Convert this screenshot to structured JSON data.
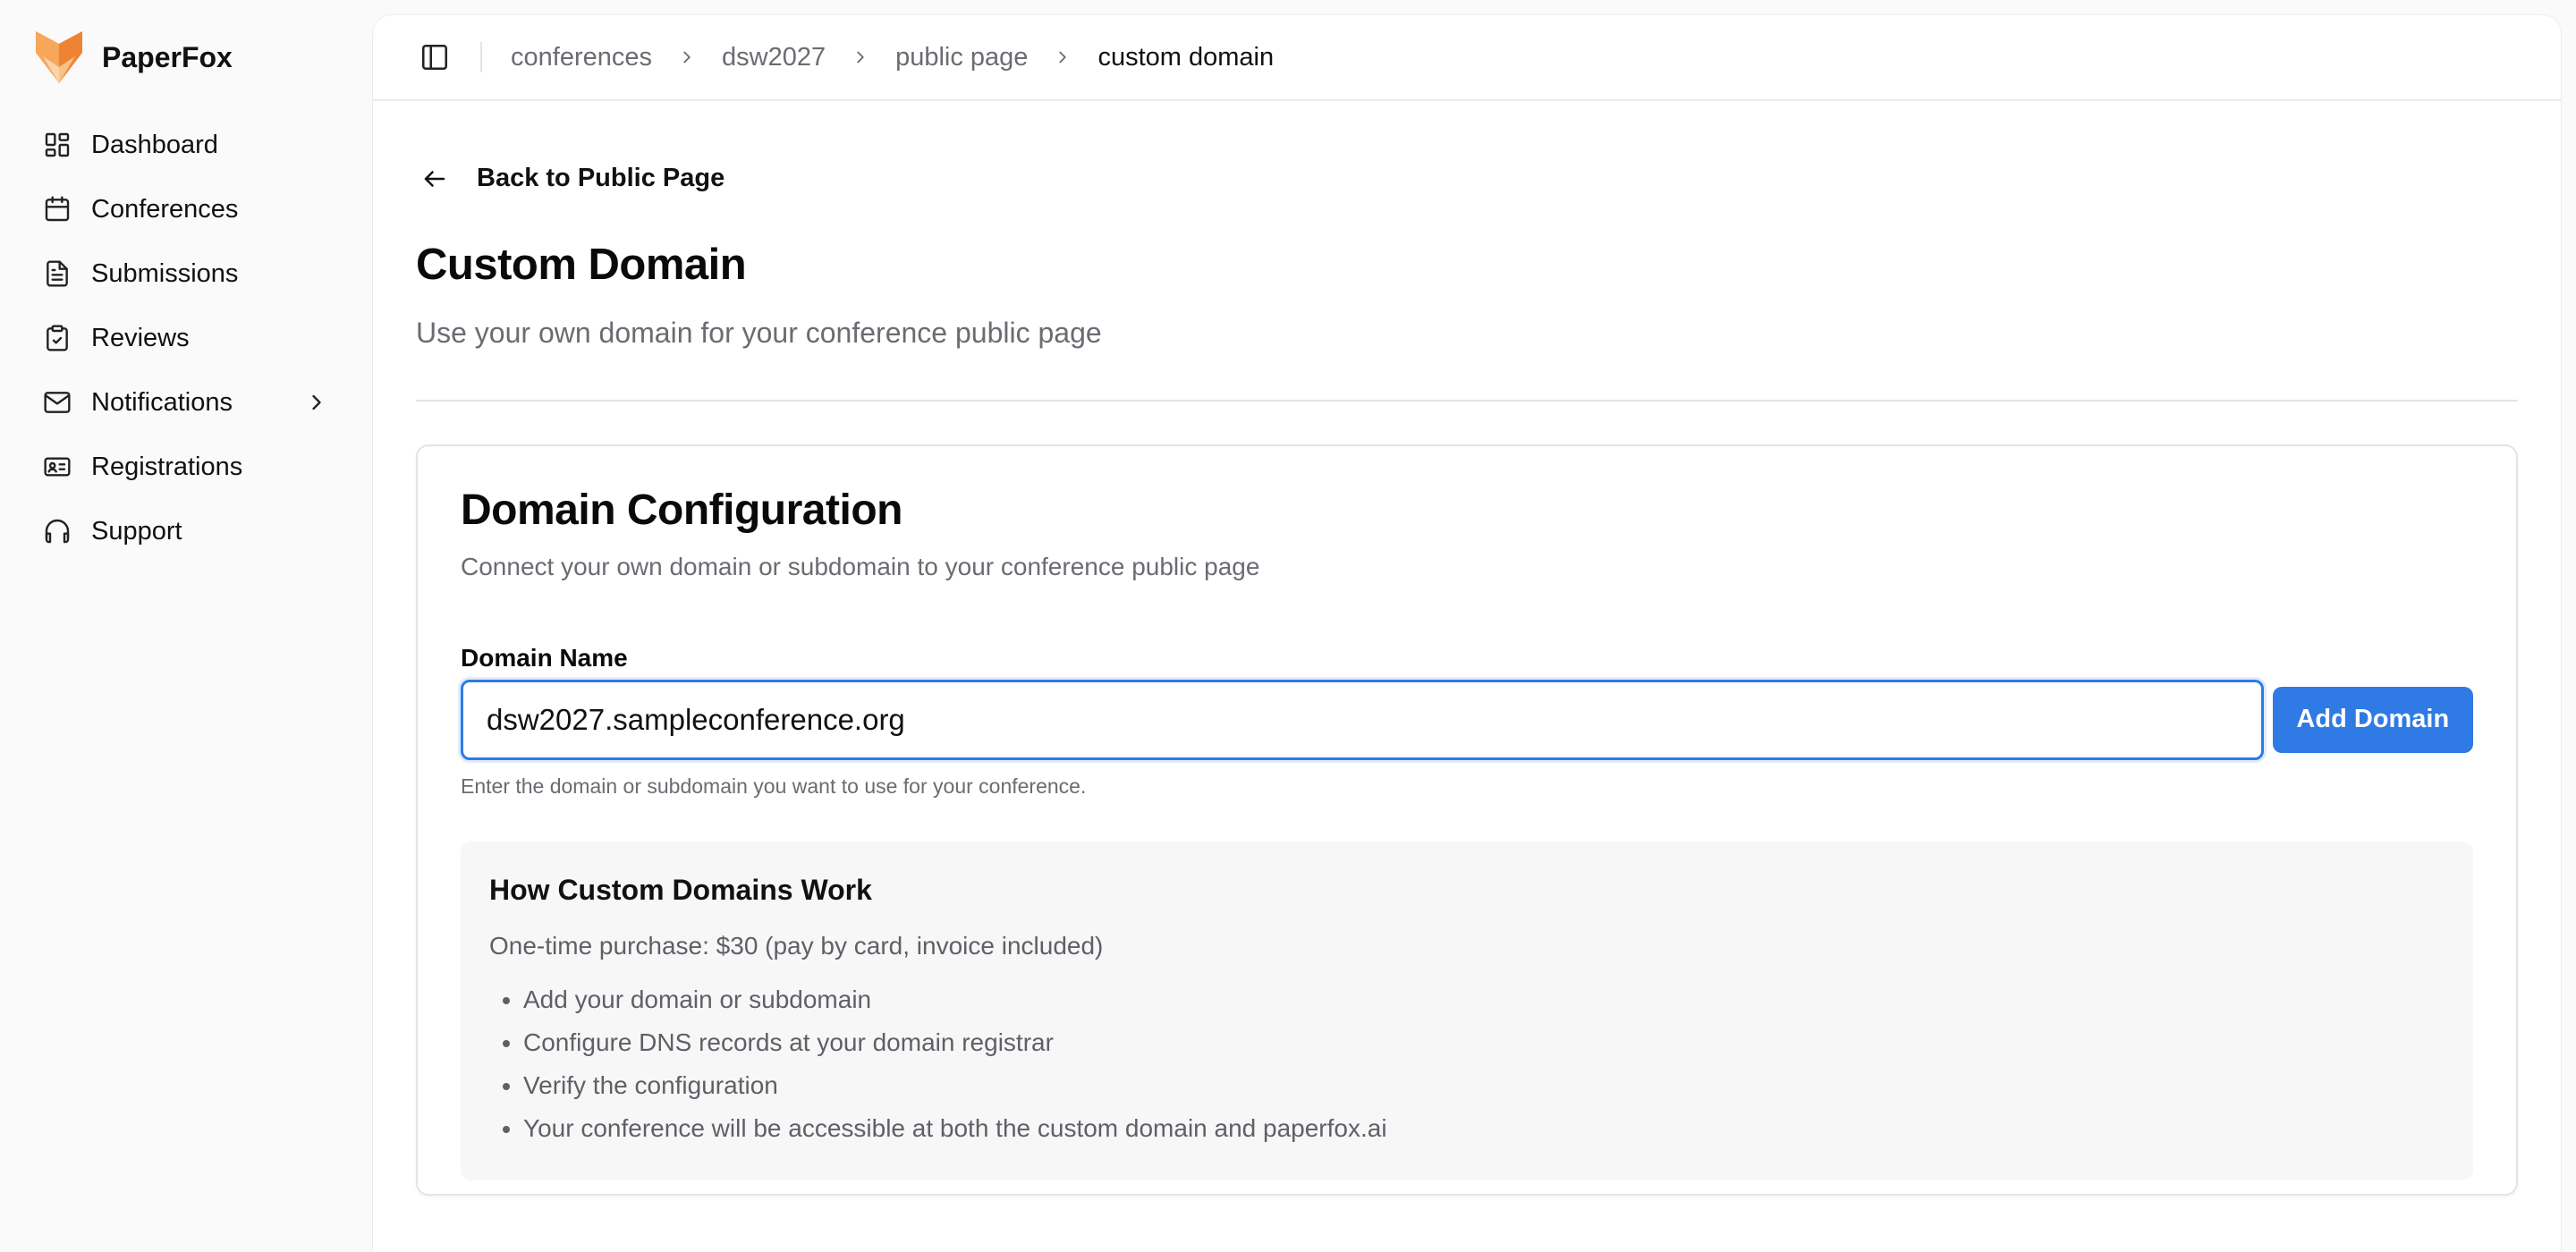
{
  "app": {
    "name": "PaperFox"
  },
  "sidebar": {
    "items": [
      {
        "label": "Dashboard",
        "icon": "dashboard-icon"
      },
      {
        "label": "Conferences",
        "icon": "calendar-icon"
      },
      {
        "label": "Submissions",
        "icon": "document-icon"
      },
      {
        "label": "Reviews",
        "icon": "clipboard-check-icon"
      },
      {
        "label": "Notifications",
        "icon": "mail-icon"
      },
      {
        "label": "Registrations",
        "icon": "id-card-icon"
      },
      {
        "label": "Support",
        "icon": "headphones-icon"
      }
    ]
  },
  "breadcrumb": [
    "conferences",
    "dsw2027",
    "public page",
    "custom domain"
  ],
  "page": {
    "back_label": "Back to Public Page",
    "title": "Custom Domain",
    "subtitle": "Use your own domain for your conference public page"
  },
  "card": {
    "title": "Domain Configuration",
    "subtitle": "Connect your own domain or subdomain to your conference public page",
    "field_label": "Domain Name",
    "field_value": "dsw2027.sampleconference.org",
    "button_label": "Add Domain",
    "hint": "Enter the domain or subdomain you want to use for your conference."
  },
  "info": {
    "title": "How Custom Domains Work",
    "price": "One-time purchase: $30 (pay by card, invoice included)",
    "steps": [
      "Add your domain or subdomain",
      "Configure DNS records at your domain registrar",
      "Verify the configuration",
      "Your conference will be accessible at both the custom domain and paperfox.ai"
    ]
  },
  "colors": {
    "accent": "#2f7ae5",
    "logo_orange": "#f39a4c"
  }
}
